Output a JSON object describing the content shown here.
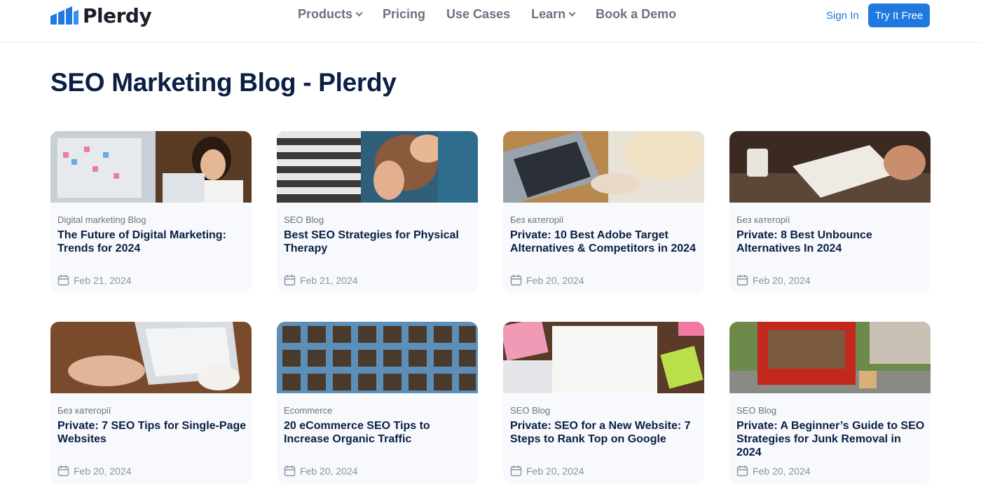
{
  "header": {
    "logo_text": "Plerdy",
    "nav": [
      {
        "label": "Products",
        "dropdown": true
      },
      {
        "label": "Pricing",
        "dropdown": false
      },
      {
        "label": "Use Cases",
        "dropdown": false
      },
      {
        "label": "Learn",
        "dropdown": true
      },
      {
        "label": "Book a Demo",
        "dropdown": false
      }
    ],
    "sign_in": "Sign In",
    "try_free": "Try It Free"
  },
  "page_title": "SEO Marketing Blog - Plerdy",
  "colors": {
    "accent": "#1f7ae0",
    "title": "#0a1f44",
    "card_bg": "#f7f9fc"
  },
  "posts": [
    {
      "category": "Digital marketing Blog",
      "title": "The Future of Digital Marketing: Trends for 2024",
      "date": "Feb 21, 2024"
    },
    {
      "category": "SEO Blog",
      "title": "Best SEO Strategies for Physical Therapy",
      "date": "Feb 21, 2024"
    },
    {
      "category": "Без категорії",
      "title": "Private: 10 Best Adobe Target Alternatives & Competitors in 2024",
      "date": "Feb 20, 2024"
    },
    {
      "category": "Без категорії",
      "title": "Private: 8 Best Unbounce Alternatives In 2024",
      "date": "Feb 20, 2024"
    },
    {
      "category": "Без категорії",
      "title": "Private: 7 SEO Tips for Single-Page Websites",
      "date": "Feb 20, 2024"
    },
    {
      "category": "Ecommerce",
      "title": "20 eCommerce SEO Tips to Increase Organic Traffic",
      "date": "Feb 20, 2024"
    },
    {
      "category": "SEO Blog",
      "title": "Private: SEO for a New Website: 7 Steps to Rank Top on Google",
      "date": "Feb 20, 2024"
    },
    {
      "category": "SEO Blog",
      "title": "Private: A Beginner’s Guide to SEO Strategies for Junk Removal in 2024",
      "date": "Feb 20, 2024"
    }
  ]
}
